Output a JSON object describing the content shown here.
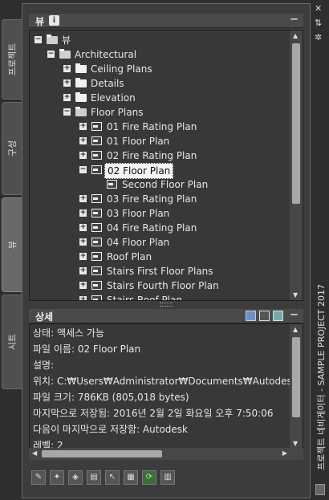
{
  "side_tabs": [
    {
      "label": "프로젝트",
      "active": false
    },
    {
      "label": "구성",
      "active": false
    },
    {
      "label": "뷰",
      "active": true
    },
    {
      "label": "시트",
      "active": false
    }
  ],
  "views_panel": {
    "title": "뷰",
    "info_badge": "i",
    "collapse": "−"
  },
  "tree": [
    {
      "label": "뷰",
      "depth": 0,
      "icon": "folder-open-icon",
      "expander": "−"
    },
    {
      "label": "Architectural",
      "depth": 1,
      "icon": "folder-open-icon",
      "expander": "−"
    },
    {
      "label": "Ceiling Plans",
      "depth": 2,
      "icon": "folder-icon",
      "expander": "+"
    },
    {
      "label": "Details",
      "depth": 2,
      "icon": "folder-icon",
      "expander": "+"
    },
    {
      "label": "Elevation",
      "depth": 2,
      "icon": "folder-icon",
      "expander": "+"
    },
    {
      "label": "Floor Plans",
      "depth": 2,
      "icon": "folder-open-icon",
      "expander": "−"
    },
    {
      "label": "01 Fire Rating Plan",
      "depth": 3,
      "icon": "view-icon",
      "expander": "+"
    },
    {
      "label": "01 Floor Plan",
      "depth": 3,
      "icon": "view-icon",
      "expander": "+"
    },
    {
      "label": "02 Fire Rating Plan",
      "depth": 3,
      "icon": "view-icon",
      "expander": "+"
    },
    {
      "label": "02 Floor Plan",
      "depth": 3,
      "icon": "view-icon",
      "expander": "−",
      "selected": true
    },
    {
      "label": "Second Floor Plan",
      "depth": 4,
      "icon": "sheet-icon",
      "expander": ""
    },
    {
      "label": "03 Fire Rating Plan",
      "depth": 3,
      "icon": "view-icon",
      "expander": "+"
    },
    {
      "label": "03 Floor Plan",
      "depth": 3,
      "icon": "view-icon",
      "expander": "+"
    },
    {
      "label": "04 Fire Rating Plan",
      "depth": 3,
      "icon": "view-icon",
      "expander": "+"
    },
    {
      "label": "04 Floor Plan",
      "depth": 3,
      "icon": "view-icon",
      "expander": "+"
    },
    {
      "label": "Roof Plan",
      "depth": 3,
      "icon": "view-icon",
      "expander": "+"
    },
    {
      "label": "Stairs First Floor Plans",
      "depth": 3,
      "icon": "stairs-icon",
      "expander": "+"
    },
    {
      "label": "Stairs Fourth Floor Plan",
      "depth": 3,
      "icon": "stairs-icon",
      "expander": "+"
    },
    {
      "label": "Stairs Roof Plan",
      "depth": 3,
      "icon": "stairs-icon",
      "expander": "+"
    }
  ],
  "details_panel": {
    "title": "상세",
    "collapse": "−"
  },
  "details": [
    "상태: 액세스 가능",
    "파일 이름: 02 Floor Plan",
    "설명:",
    "위치: C:₩Users₩Administrator₩Documents₩Autodesk₩내 프",
    "파일 크기: 786KB (805,018 bytes)",
    "마지막으로 저장됨: 2016년 2월 2일 화요일  오후 7:50:06",
    "다음이 마지막으로 저장함: Autodesk",
    "레벨: 2"
  ],
  "side_title": "프로젝트 네비게이터 - SAMPLE PROJECT 2017",
  "window_icons": [
    "close-icon",
    "autohide-icon",
    "properties-icon"
  ],
  "toolbar": [
    "new-view-icon",
    "new-callout-icon",
    "new-section-icon",
    "clipboard-icon",
    "regenerate-icon",
    "properties-grid-icon",
    "refresh-icon",
    "repath-icon"
  ]
}
